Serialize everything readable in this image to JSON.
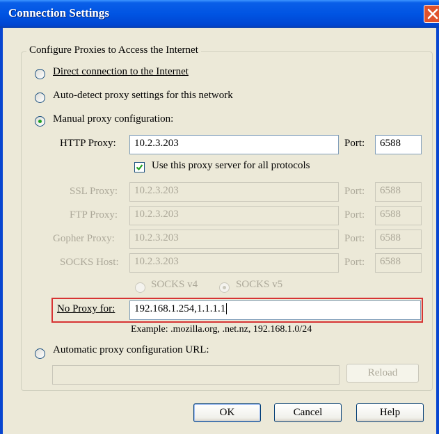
{
  "window": {
    "title": "Connection Settings"
  },
  "group": {
    "legend": "Configure Proxies to Access the Internet"
  },
  "options": {
    "direct": "Direct connection to the Internet",
    "autodetect": "Auto-detect proxy settings for this network",
    "manual": "Manual proxy configuration:",
    "auto_url": "Automatic proxy configuration URL:",
    "selected": "manual"
  },
  "http": {
    "label": "HTTP Proxy:",
    "value": "10.2.3.203",
    "port_label": "Port:",
    "port": "6588"
  },
  "share": {
    "label": "Use this proxy server for all protocols",
    "checked": true
  },
  "ssl": {
    "label": "SSL Proxy:",
    "value": "10.2.3.203",
    "port_label": "Port:",
    "port": "6588"
  },
  "ftp": {
    "label": "FTP Proxy:",
    "value": "10.2.3.203",
    "port_label": "Port:",
    "port": "6588"
  },
  "gopher": {
    "label": "Gopher Proxy:",
    "value": "10.2.3.203",
    "port_label": "Port:",
    "port": "6588"
  },
  "socks": {
    "label": "SOCKS Host:",
    "value": "10.2.3.203",
    "port_label": "Port:",
    "port": "6588",
    "v4": "SOCKS v4",
    "v5": "SOCKS v5",
    "selected": "v5"
  },
  "noproxy": {
    "label": "No Proxy for:",
    "value": "192.168.1.254,1.1.1.1",
    "example": "Example: .mozilla.org, .net.nz, 192.168.1.0/24"
  },
  "autourl": {
    "value": "",
    "reload": "Reload"
  },
  "buttons": {
    "ok": "OK",
    "cancel": "Cancel",
    "help": "Help"
  },
  "colors": {
    "titlebar": "#0054E3",
    "highlight": "#D73333",
    "check": "#21A121"
  }
}
